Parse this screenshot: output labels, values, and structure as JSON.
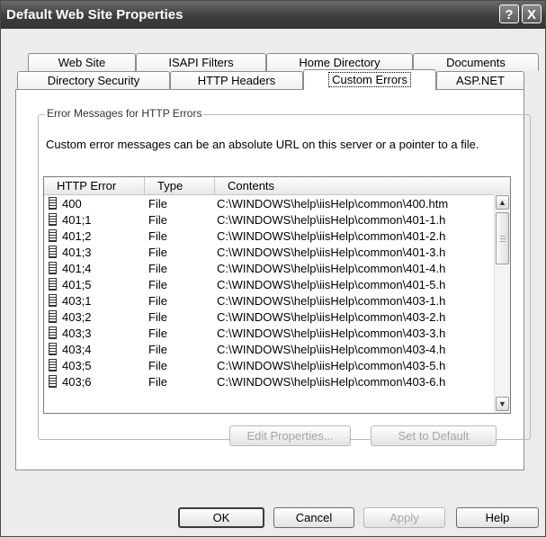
{
  "window": {
    "title": "Default Web Site Properties",
    "help_glyph": "?",
    "close_glyph": "X"
  },
  "tabs": {
    "row1": [
      "Web Site",
      "ISAPI Filters",
      "Home Directory",
      "Documents"
    ],
    "row2": [
      "Directory Security",
      "HTTP Headers",
      "Custom Errors",
      "ASP.NET"
    ],
    "active": "Custom Errors"
  },
  "group": {
    "label": "Error Messages for HTTP Errors",
    "description": "Custom error messages can be an absolute URL on this server or a pointer to a file."
  },
  "list": {
    "columns": [
      "HTTP Error",
      "Type",
      "Contents"
    ],
    "rows": [
      {
        "error": "400",
        "type": "File",
        "contents": "C:\\WINDOWS\\help\\iisHelp\\common\\400.htm"
      },
      {
        "error": "401;1",
        "type": "File",
        "contents": "C:\\WINDOWS\\help\\iisHelp\\common\\401-1.h"
      },
      {
        "error": "401;2",
        "type": "File",
        "contents": "C:\\WINDOWS\\help\\iisHelp\\common\\401-2.h"
      },
      {
        "error": "401;3",
        "type": "File",
        "contents": "C:\\WINDOWS\\help\\iisHelp\\common\\401-3.h"
      },
      {
        "error": "401;4",
        "type": "File",
        "contents": "C:\\WINDOWS\\help\\iisHelp\\common\\401-4.h"
      },
      {
        "error": "401;5",
        "type": "File",
        "contents": "C:\\WINDOWS\\help\\iisHelp\\common\\401-5.h"
      },
      {
        "error": "403;1",
        "type": "File",
        "contents": "C:\\WINDOWS\\help\\iisHelp\\common\\403-1.h"
      },
      {
        "error": "403;2",
        "type": "File",
        "contents": "C:\\WINDOWS\\help\\iisHelp\\common\\403-2.h"
      },
      {
        "error": "403;3",
        "type": "File",
        "contents": "C:\\WINDOWS\\help\\iisHelp\\common\\403-3.h"
      },
      {
        "error": "403;4",
        "type": "File",
        "contents": "C:\\WINDOWS\\help\\iisHelp\\common\\403-4.h"
      },
      {
        "error": "403;5",
        "type": "File",
        "contents": "C:\\WINDOWS\\help\\iisHelp\\common\\403-5.h"
      },
      {
        "error": "403;6",
        "type": "File",
        "contents": "C:\\WINDOWS\\help\\iisHelp\\common\\403-6.h"
      }
    ]
  },
  "buttons": {
    "edit_properties": "Edit Properties...",
    "set_to_default": "Set to Default",
    "ok": "OK",
    "cancel": "Cancel",
    "apply": "Apply",
    "help": "Help"
  },
  "icons": {
    "row_icon": "document-icon",
    "scroll_up": "arrow-up-icon",
    "scroll_down": "arrow-down-icon"
  }
}
